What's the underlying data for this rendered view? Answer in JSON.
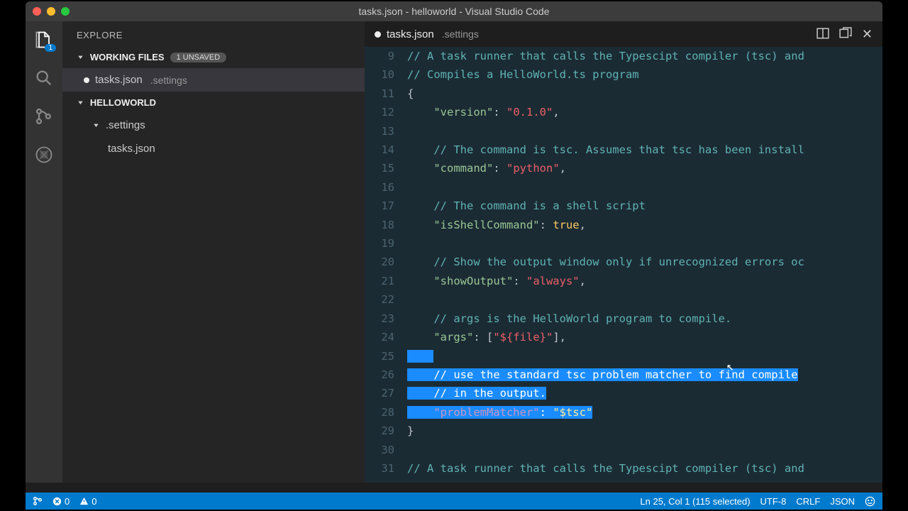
{
  "titlebar": {
    "title": "tasks.json - helloworld - Visual Studio Code"
  },
  "activity": {
    "badge": "1"
  },
  "sidebar": {
    "title": "EXPLORE",
    "working_files": {
      "label": "WORKING FILES",
      "badge": "1 UNSAVED"
    },
    "wf_item": {
      "name": "tasks.json",
      "sub": ".settings"
    },
    "project": "HELLOWORLD",
    "folder": ".settings",
    "file": "tasks.json"
  },
  "tab": {
    "name": "tasks.json",
    "sub": ".settings"
  },
  "code": [
    {
      "n": 9,
      "t": [
        [
          "cm",
          "// A task runner that calls the Typescipt compiler (tsc) and"
        ]
      ]
    },
    {
      "n": 10,
      "t": [
        [
          "cm",
          "// Compiles a HelloWorld.ts program"
        ]
      ]
    },
    {
      "n": 11,
      "t": [
        [
          "p",
          "{"
        ]
      ]
    },
    {
      "n": 12,
      "t": [
        [
          "p",
          "    "
        ],
        [
          "key",
          "\"version\""
        ],
        [
          "p",
          ": "
        ],
        [
          "str",
          "\"0.1.0\""
        ],
        [
          "p",
          ","
        ]
      ]
    },
    {
      "n": 13,
      "t": [
        [
          "p",
          ""
        ]
      ]
    },
    {
      "n": 14,
      "t": [
        [
          "p",
          "    "
        ],
        [
          "cm",
          "// The command is tsc. Assumes that tsc has been install"
        ]
      ]
    },
    {
      "n": 15,
      "t": [
        [
          "p",
          "    "
        ],
        [
          "key",
          "\"command\""
        ],
        [
          "p",
          ": "
        ],
        [
          "str",
          "\"python\""
        ],
        [
          "p",
          ","
        ]
      ]
    },
    {
      "n": 16,
      "t": [
        [
          "p",
          ""
        ]
      ]
    },
    {
      "n": 17,
      "t": [
        [
          "p",
          "    "
        ],
        [
          "cm",
          "// The command is a shell script"
        ]
      ]
    },
    {
      "n": 18,
      "t": [
        [
          "p",
          "    "
        ],
        [
          "key",
          "\"isShellCommand\""
        ],
        [
          "p",
          ": "
        ],
        [
          "kw",
          "true"
        ],
        [
          "p",
          ","
        ]
      ]
    },
    {
      "n": 19,
      "t": [
        [
          "p",
          ""
        ]
      ]
    },
    {
      "n": 20,
      "t": [
        [
          "p",
          "    "
        ],
        [
          "cm",
          "// Show the output window only if unrecognized errors oc"
        ]
      ]
    },
    {
      "n": 21,
      "t": [
        [
          "p",
          "    "
        ],
        [
          "key",
          "\"showOutput\""
        ],
        [
          "p",
          ": "
        ],
        [
          "str",
          "\"always\""
        ],
        [
          "p",
          ","
        ]
      ]
    },
    {
      "n": 22,
      "t": [
        [
          "p",
          ""
        ]
      ]
    },
    {
      "n": 23,
      "t": [
        [
          "p",
          "    "
        ],
        [
          "cm",
          "// args is the HelloWorld program to compile."
        ]
      ]
    },
    {
      "n": 24,
      "t": [
        [
          "p",
          "    "
        ],
        [
          "key",
          "\"args\""
        ],
        [
          "p",
          ": ["
        ],
        [
          "str",
          "\"${file}\""
        ],
        [
          "p",
          "],"
        ]
      ]
    },
    {
      "n": 25,
      "sel": true,
      "t": [
        [
          "p",
          "    "
        ]
      ]
    },
    {
      "n": 26,
      "sel": true,
      "t": [
        [
          "p",
          "    "
        ],
        [
          "cm",
          "// use the standard tsc problem matcher to find compile"
        ]
      ]
    },
    {
      "n": 27,
      "sel": true,
      "t": [
        [
          "p",
          "    "
        ],
        [
          "cm",
          "// in the output."
        ]
      ]
    },
    {
      "n": 28,
      "sel": true,
      "t": [
        [
          "p",
          "    "
        ],
        [
          "key",
          "\"problemMatcher\""
        ],
        [
          "p",
          ": "
        ],
        [
          "str",
          "\"$tsc\""
        ]
      ]
    },
    {
      "n": 29,
      "t": [
        [
          "p",
          "}"
        ]
      ]
    },
    {
      "n": 30,
      "t": [
        [
          "p",
          ""
        ]
      ]
    },
    {
      "n": 31,
      "t": [
        [
          "cm",
          "// A task runner that calls the Typescipt compiler (tsc) and"
        ]
      ]
    }
  ],
  "status": {
    "errors": "0",
    "warnings": "0",
    "cursor": "Ln 25, Col 1 (115 selected)",
    "encoding": "UTF-8",
    "eol": "CRLF",
    "lang": "JSON"
  }
}
